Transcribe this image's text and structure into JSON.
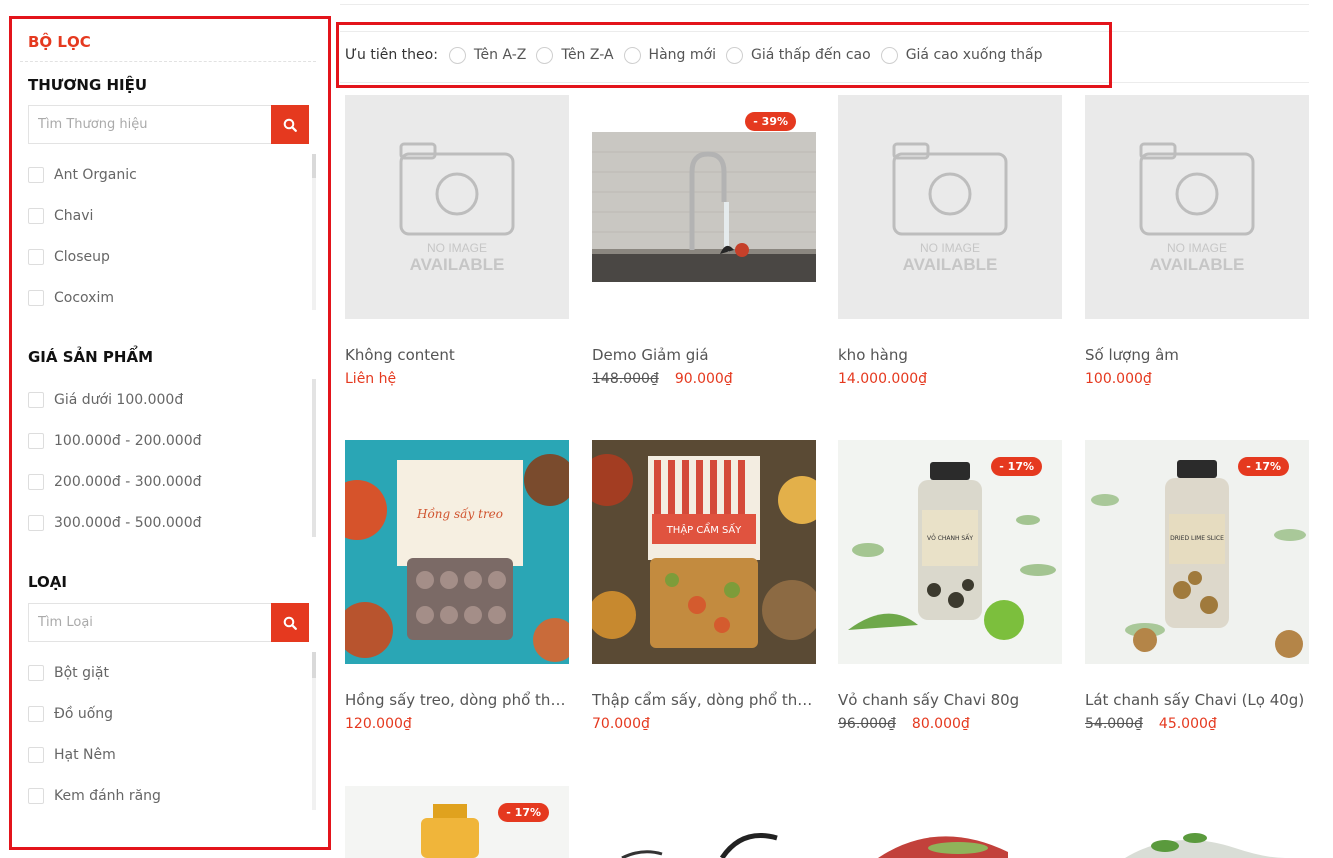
{
  "sidebar": {
    "title": "BỘ LỌC",
    "brand": {
      "title": "THƯƠNG HIỆU",
      "placeholder": "Tìm Thương hiệu",
      "items": [
        "Ant Organic",
        "Chavi",
        "Closeup",
        "Cocoxim"
      ]
    },
    "price": {
      "title": "GIÁ SẢN PHẨM",
      "items": [
        "Giá dưới 100.000đ",
        "100.000đ - 200.000đ",
        "200.000đ - 300.000đ",
        "300.000đ - 500.000đ"
      ]
    },
    "type": {
      "title": "LOẠI",
      "placeholder": "Tìm Loại",
      "items": [
        "Bột giặt",
        "Đồ uống",
        "Hạt Nêm",
        "Kem đánh răng"
      ]
    }
  },
  "sort": {
    "label": "Ưu tiên theo:",
    "options": [
      "Tên A-Z",
      "Tên Z-A",
      "Hàng mới",
      "Giá thấp đến cao",
      "Giá cao xuống thấp"
    ]
  },
  "no_image": {
    "line1": "NO IMAGE",
    "line2": "AVAILABLE"
  },
  "products": [
    {
      "name": "Không content",
      "price": "Liên hệ",
      "old_price": "",
      "badge": ""
    },
    {
      "name": "Demo Giảm giá",
      "price": "90.000₫",
      "old_price": "148.000₫",
      "badge": "- 39%"
    },
    {
      "name": "kho hàng",
      "price": "14.000.000₫",
      "old_price": "",
      "badge": ""
    },
    {
      "name": "Số lượng âm",
      "price": "100.000₫",
      "old_price": "",
      "badge": ""
    },
    {
      "name": "Hồng sấy treo, dòng phổ thông",
      "price": "120.000₫",
      "old_price": "",
      "badge": ""
    },
    {
      "name": "Thập cẩm sấy, dòng phổ thông",
      "price": "70.000₫",
      "old_price": "",
      "badge": ""
    },
    {
      "name": "Vỏ chanh sấy Chavi 80g",
      "price": "80.000₫",
      "old_price": "96.000₫",
      "badge": "- 17%"
    },
    {
      "name": "Lát chanh sấy Chavi (Lọ 40g)",
      "price": "45.000₫",
      "old_price": "54.000₫",
      "badge": "- 17%"
    },
    {
      "name": "",
      "price": "",
      "old_price": "",
      "badge": "- 17%"
    }
  ],
  "image_labels": {
    "persimmon_title": "Hồng sấy treo",
    "mix_title": "THẬP CẨM SẤY",
    "peel_label": "VỎ CHANH SẤY",
    "slice_label": "DRIED LIME SLICE"
  },
  "colors": {
    "accent": "#e5391f",
    "highlight_border": "#e3141b"
  }
}
